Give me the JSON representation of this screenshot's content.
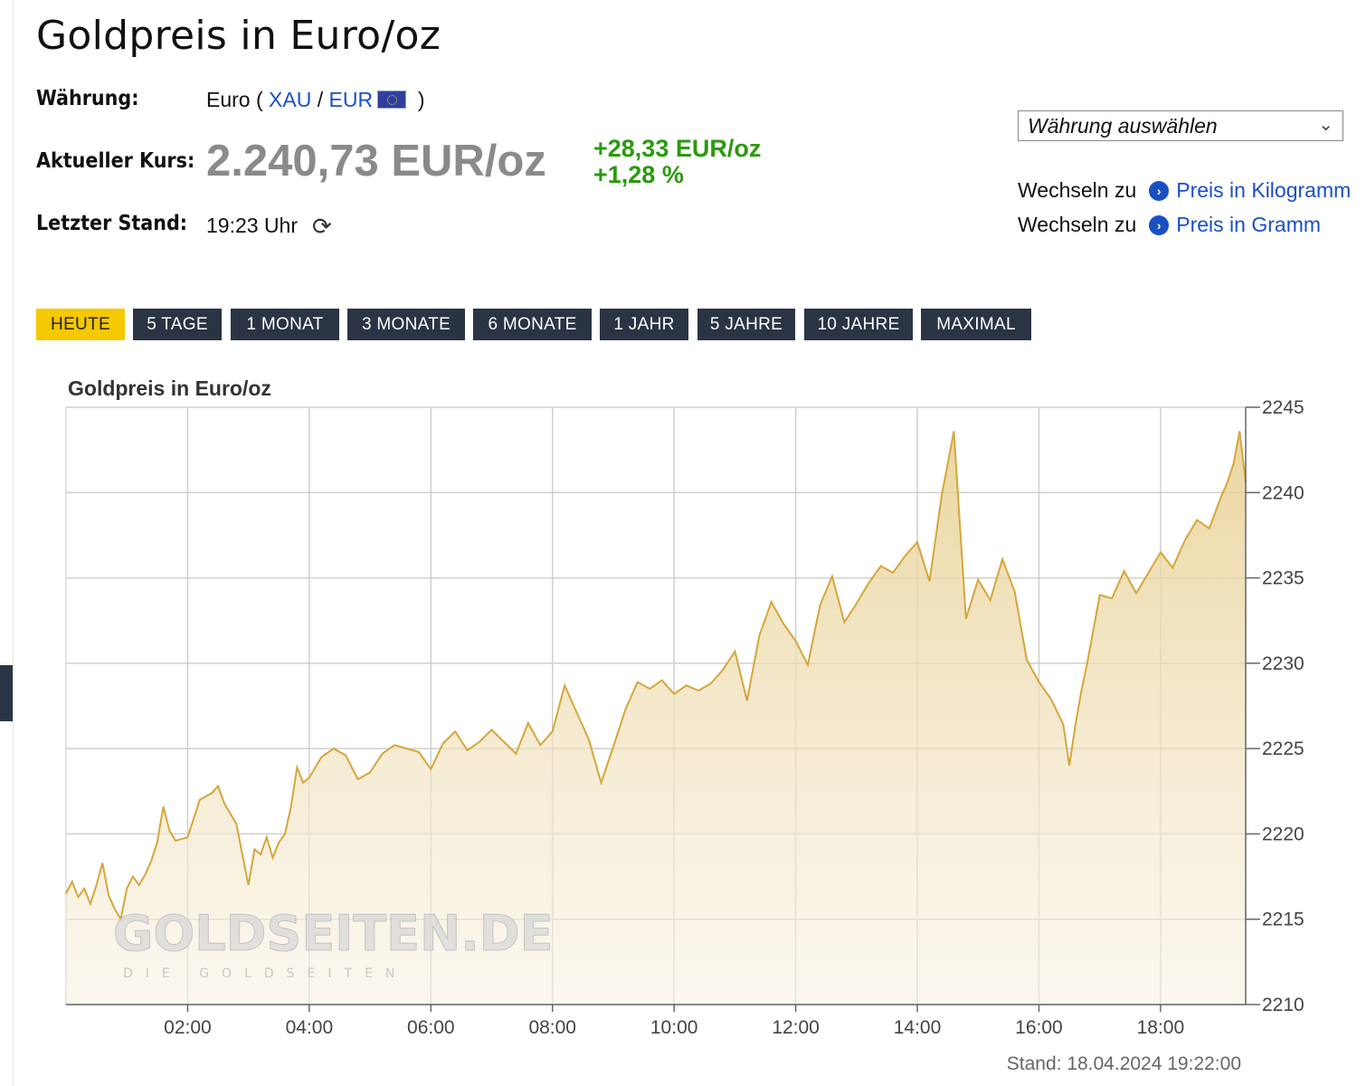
{
  "page": {
    "title": "Goldpreis in Euro/oz",
    "waehrung_label": "Währung:",
    "waehrung_prefix": "Euro (",
    "waehrung_xau": "XAU",
    "waehrung_sep": "/",
    "waehrung_eur": "EUR",
    "waehrung_suffix": ")",
    "kurs_label": "Aktueller Kurs:",
    "kurs_value": "2.240,73 EUR/oz",
    "change_abs": "+28,33 EUR/oz",
    "change_pct": "+1,28 %",
    "stand_label": "Letzter Stand:",
    "stand_value": "19:23 Uhr",
    "currency_select": "Währung auswählen",
    "switch_prefix": "Wechseln zu",
    "switch_kg": "Preis in Kilogramm",
    "switch_g": "Preis in Gramm",
    "colors": {
      "accent": "#f5c800",
      "tab_bg": "#2b3444",
      "link": "#1a4fc4",
      "positive": "#2a9a0e",
      "line": "#d6a63a"
    }
  },
  "tabs": [
    "HEUTE",
    "5 TAGE",
    "1 MONAT",
    "3 MONATE",
    "6 MONATE",
    "1 JAHR",
    "5 JAHRE",
    "10 JAHRE",
    "MAXIMAL"
  ],
  "active_tab": "HEUTE",
  "chart_data": {
    "type": "area",
    "title": "Goldpreis in Euro/oz",
    "xlabel": "",
    "ylabel": "",
    "x_ticks": [
      "02:00",
      "04:00",
      "06:00",
      "08:00",
      "10:00",
      "12:00",
      "14:00",
      "16:00",
      "18:00"
    ],
    "y_ticks": [
      2210,
      2215,
      2220,
      2225,
      2230,
      2235,
      2240,
      2245
    ],
    "ylim": [
      2210,
      2245
    ],
    "xlim_hours": [
      0.0,
      19.4
    ],
    "grid": true,
    "watermark": "GOLDSEITEN.DE",
    "watermark_sub": "DIE GOLDSEITEN",
    "footer": "Stand: 18.04.2024 19:22:00",
    "series": [
      {
        "x": [
          0.0,
          0.1,
          0.2,
          0.3,
          0.4,
          0.5,
          0.6,
          0.7,
          0.8,
          0.9,
          1.0,
          1.1,
          1.2,
          1.3,
          1.4,
          1.5,
          1.6,
          1.7,
          1.8,
          1.9,
          2.0,
          2.2,
          2.4,
          2.5,
          2.6,
          2.8,
          3.0,
          3.1,
          3.2,
          3.3,
          3.4,
          3.5,
          3.6,
          3.7,
          3.8,
          3.9,
          4.0,
          4.2,
          4.4,
          4.6,
          4.8,
          5.0,
          5.2,
          5.4,
          5.6,
          5.8,
          6.0,
          6.2,
          6.4,
          6.6,
          6.8,
          7.0,
          7.2,
          7.4,
          7.6,
          7.8,
          8.0,
          8.2,
          8.4,
          8.6,
          8.8,
          9.0,
          9.2,
          9.4,
          9.6,
          9.8,
          10.0,
          10.2,
          10.4,
          10.6,
          10.8,
          11.0,
          11.2,
          11.4,
          11.6,
          11.8,
          12.0,
          12.2,
          12.4,
          12.6,
          12.8,
          13.0,
          13.2,
          13.4,
          13.6,
          13.8,
          14.0,
          14.2,
          14.4,
          14.6,
          14.8,
          15.0,
          15.2,
          15.4,
          15.6,
          15.8,
          16.0,
          16.2,
          16.4,
          16.5,
          16.6,
          16.7,
          16.8,
          17.0,
          17.2,
          17.4,
          17.6,
          17.8,
          18.0,
          18.2,
          18.4,
          18.6,
          18.8,
          19.0,
          19.1,
          19.2,
          19.3,
          19.4
        ],
        "y": [
          2216.5,
          2217.2,
          2216.3,
          2216.8,
          2215.9,
          2217.0,
          2218.3,
          2216.4,
          2215.6,
          2215.0,
          2216.8,
          2217.5,
          2217.0,
          2217.6,
          2218.4,
          2219.5,
          2221.6,
          2220.2,
          2219.6,
          2219.7,
          2219.8,
          2222.0,
          2222.4,
          2222.8,
          2221.8,
          2220.6,
          2217.0,
          2219.1,
          2218.8,
          2219.8,
          2218.6,
          2219.5,
          2220.0,
          2221.6,
          2223.9,
          2223.0,
          2223.3,
          2224.5,
          2225.0,
          2224.6,
          2223.2,
          2223.6,
          2224.7,
          2225.2,
          2225.0,
          2224.8,
          2223.8,
          2225.3,
          2226.0,
          2224.9,
          2225.4,
          2226.1,
          2225.4,
          2224.7,
          2226.5,
          2225.2,
          2226.0,
          2228.7,
          2227.1,
          2225.5,
          2223.0,
          2225.1,
          2227.3,
          2228.9,
          2228.5,
          2229.0,
          2228.2,
          2228.7,
          2228.4,
          2228.8,
          2229.6,
          2230.7,
          2227.8,
          2231.6,
          2233.6,
          2232.3,
          2231.3,
          2229.9,
          2233.4,
          2235.1,
          2232.4,
          2233.5,
          2234.7,
          2235.7,
          2235.3,
          2236.3,
          2237.1,
          2234.8,
          2239.8,
          2243.6,
          2232.6,
          2234.9,
          2233.7,
          2236.1,
          2234.2,
          2230.2,
          2228.9,
          2227.9,
          2226.4,
          2224.0,
          2226.4,
          2228.4,
          2230.1,
          2234.0,
          2233.8,
          2235.4,
          2234.1,
          2235.3,
          2236.5,
          2235.6,
          2237.2,
          2238.4,
          2237.9,
          2239.8,
          2240.6,
          2241.7,
          2243.6,
          2240.6
        ],
        "name": ""
      }
    ]
  }
}
